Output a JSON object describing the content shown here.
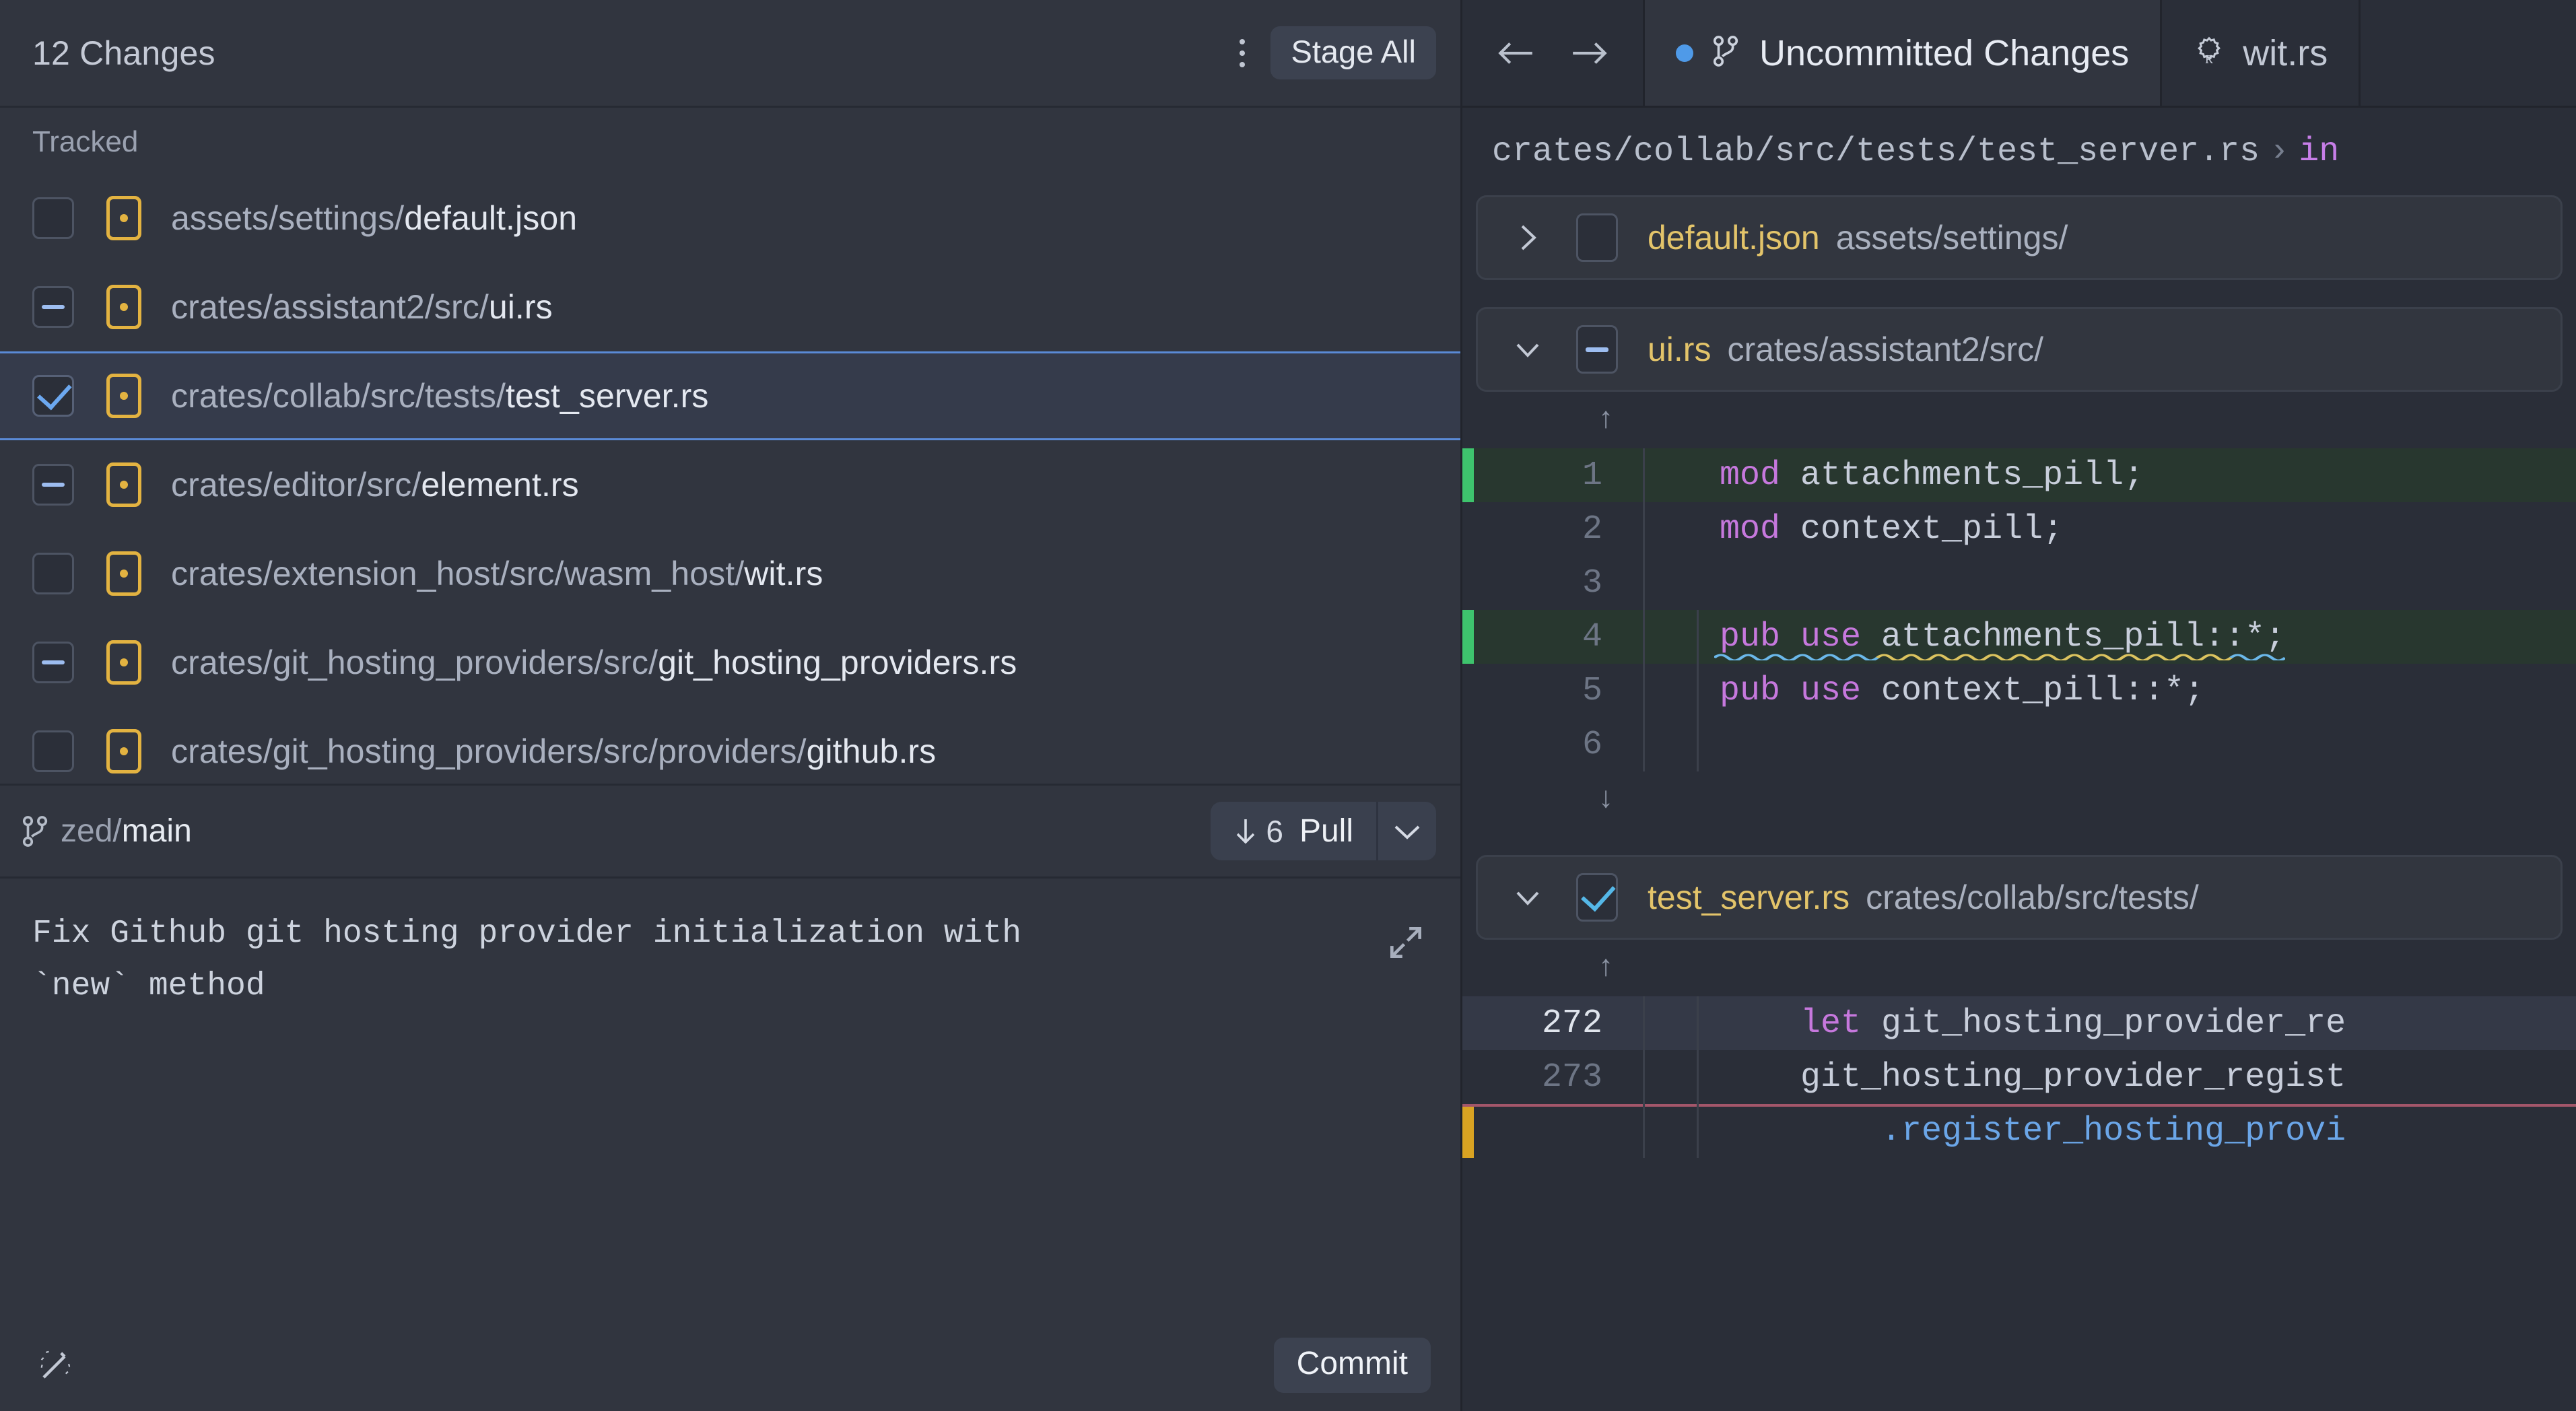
{
  "left_panel": {
    "header": {
      "changes_count": "12 Changes",
      "kebab_icon": "kebab-menu-icon",
      "stage_all_label": "Stage All"
    },
    "section_label": "Tracked",
    "files": [
      {
        "state": "unchecked",
        "dir": "assets/settings/",
        "name": "default.json"
      },
      {
        "state": "indeterminate",
        "dir": "crates/assistant2/src/",
        "name": "ui.rs"
      },
      {
        "state": "checked",
        "dir": "crates/collab/src/tests/",
        "name": "test_server.rs",
        "selected": true
      },
      {
        "state": "indeterminate",
        "dir": "crates/editor/src/",
        "name": "element.rs"
      },
      {
        "state": "unchecked",
        "dir": "crates/extension_host/src/wasm_host/",
        "name": "wit.rs"
      },
      {
        "state": "indeterminate",
        "dir": "crates/git_hosting_providers/src/",
        "name": "git_hosting_providers.rs"
      },
      {
        "state": "unchecked",
        "dir": "crates/git_hosting_providers/src/providers/",
        "name": "github.rs"
      }
    ],
    "branch": {
      "icon": "git-branch-icon",
      "remote": "zed/",
      "name": "main"
    },
    "pull": {
      "arrow_icon": "arrow-down-icon",
      "count": "6",
      "label": "Pull",
      "caret_icon": "chevron-down-icon"
    },
    "commit": {
      "message": "Fix Github git hosting provider initialization with `new` method",
      "expand_icon": "expand-diagonal-icon",
      "wand_icon": "magic-wand-icon",
      "button_label": "Commit"
    }
  },
  "right_panel": {
    "nav": {
      "back_icon": "arrow-left-icon",
      "forward_icon": "arrow-right-icon"
    },
    "tabs": [
      {
        "label": "Uncommitted Changes",
        "icon": "git-branch-icon",
        "dirty": true,
        "active": true
      },
      {
        "label": "wit.rs",
        "icon": "rust-file-icon",
        "dirty": false,
        "active": false
      }
    ],
    "breadcrumb": {
      "path": "crates/collab/src/tests/test_server.rs",
      "separator": "›",
      "symbol": "in"
    },
    "diff_files": [
      {
        "expanded": false,
        "chevron": "chevron-right-icon",
        "checkbox": "unchecked",
        "name": "default.json",
        "dir": "assets/settings/"
      },
      {
        "expanded": true,
        "chevron": "chevron-down-icon",
        "checkbox": "indeterminate",
        "name": "ui.rs",
        "dir": "crates/assistant2/src/",
        "lines": [
          {
            "kind": "handle",
            "glyph": "↑"
          },
          {
            "no": "1",
            "kind": "added",
            "text": "mod attachments_pill;",
            "kw": "mod"
          },
          {
            "no": "2",
            "kind": "normal",
            "text": "mod context_pill;",
            "kw": "mod"
          },
          {
            "no": "3",
            "kind": "normal",
            "text": ""
          },
          {
            "no": "4",
            "kind": "added",
            "text": "pub use attachments_pill::*;",
            "kw": "pub use",
            "squiggle": true
          },
          {
            "no": "5",
            "kind": "normal",
            "text": "pub use context_pill::*;",
            "kw": "pub use"
          },
          {
            "no": "6",
            "kind": "normal",
            "text": ""
          },
          {
            "kind": "handle",
            "glyph": "↓"
          }
        ]
      },
      {
        "expanded": true,
        "chevron": "chevron-down-icon",
        "checkbox": "checked",
        "name": "test_server.rs",
        "dir": "crates/collab/src/tests/",
        "lines": [
          {
            "kind": "handle",
            "glyph": "↑"
          },
          {
            "no": "272",
            "kind": "cursorline",
            "text": "let git_hosting_provider_re",
            "kw": "let"
          },
          {
            "no": "273",
            "kind": "normal",
            "text": "git_hosting_provider_regist"
          },
          {
            "no": "",
            "kind": "modified",
            "text": ".register_hosting_provi",
            "fn_colored": true
          }
        ]
      }
    ]
  },
  "colors": {
    "accent_blue": "#4f9ae8",
    "added_green": "#3ec46d",
    "modified_yellow": "#d9a322",
    "file_yellow": "#e3c46a",
    "keyword_purple": "#c678dd",
    "panel_bg": "#31353f",
    "editor_bg": "#2a2e38"
  }
}
